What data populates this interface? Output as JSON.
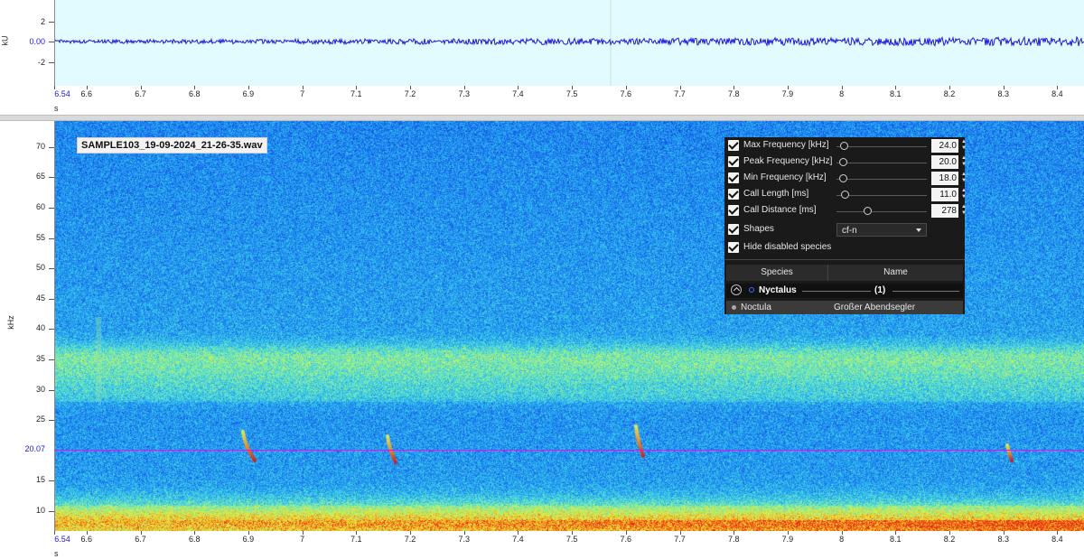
{
  "waveform": {
    "unit_label": "kU",
    "y_ticks": [
      "2",
      "0.00",
      "-2"
    ],
    "x_unit": "s",
    "x_start_label": "6.54",
    "x_ticks": [
      "6.6",
      "6.7",
      "6.8",
      "6.9",
      "7",
      "7.1",
      "7.2",
      "7.3",
      "7.4",
      "7.5",
      "7.6",
      "7.7",
      "7.8",
      "7.9",
      "8",
      "8.1",
      "8.2",
      "8.3",
      "8.4"
    ]
  },
  "spectrogram": {
    "filename": "SAMPLE103_19-09-2024_21-26-35.wav",
    "y_unit": "kHz",
    "y_ticks": [
      "70",
      "65",
      "60",
      "55",
      "50",
      "45",
      "40",
      "35",
      "30",
      "25",
      "15",
      "10"
    ],
    "cursor_label": "20.07",
    "x_unit": "s",
    "x_start_label": "6.54",
    "x_ticks": [
      "6.6",
      "6.7",
      "6.8",
      "6.9",
      "7",
      "7.1",
      "7.2",
      "7.3",
      "7.4",
      "7.5",
      "7.6",
      "7.7",
      "7.8",
      "7.9",
      "8",
      "8.1",
      "8.2",
      "8.3",
      "8.4"
    ]
  },
  "filter_panel": {
    "rows": [
      {
        "label": "Max Frequency [kHz]",
        "value": "24.0",
        "checked": true,
        "slider_fraction": 0.04
      },
      {
        "label": "Peak Frequency [kHz]",
        "value": "20.0",
        "checked": true,
        "slider_fraction": 0.03
      },
      {
        "label": "Min Frequency [kHz]",
        "value": "18.0",
        "checked": true,
        "slider_fraction": 0.03
      },
      {
        "label": "Call Length [ms]",
        "value": "11.0",
        "checked": true,
        "slider_fraction": 0.05
      },
      {
        "label": "Call Distance [ms]",
        "value": "278",
        "checked": true,
        "slider_fraction": 0.3
      }
    ],
    "shapes_label": "Shapes",
    "shapes_value": "cf-n",
    "hide_label": "Hide disabled species",
    "table_headers": [
      "Species",
      "Name"
    ],
    "group_name": "Nyctalus",
    "group_count": "(1)",
    "item_species": "Noctula",
    "item_name": "Großer Abendsegler"
  },
  "colors": {
    "wave_bg": "#e2fbff",
    "wave_line": "#1a1ad8",
    "spec_base": "#1a4fd8",
    "cursor": "#ff00ff",
    "panel_bg": "#1a1a1a"
  }
}
